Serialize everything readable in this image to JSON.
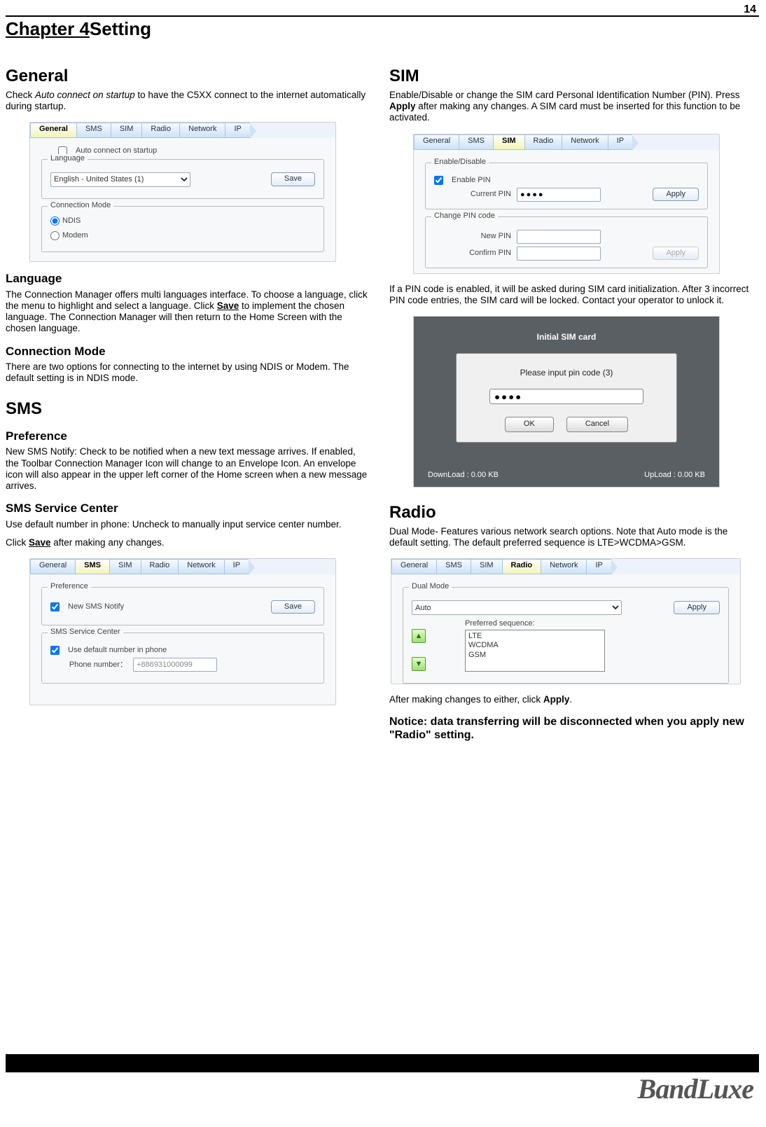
{
  "page_number": "14",
  "chapter": {
    "label": "Chapter 4",
    "title": "Setting"
  },
  "left": {
    "general": {
      "heading": "General",
      "intro_part1": "Check ",
      "intro_italic": "Auto connect on startup",
      "intro_part2": " to have the C5XX connect to the internet automatically during startup."
    },
    "general_fig": {
      "tabs": [
        "General",
        "SMS",
        "SIM",
        "Radio",
        "Network",
        "IP"
      ],
      "active": "General",
      "auto_connect_label": "Auto connect on startup",
      "language_legend": "Language",
      "language_value": "English - United States (1)",
      "save_btn": "Save",
      "conn_legend": "Connection Mode",
      "radio_ndis": "NDIS",
      "radio_modem": "Modem"
    },
    "language": {
      "heading": "Language",
      "body_1": "The Connection Manager offers multi languages interface. To choose a language, click the menu to highlight and select a language. Click ",
      "body_save": "Save",
      "body_2": " to implement the chosen language. The Connection Manager will then return to the Home Screen with the chosen language."
    },
    "conn_mode": {
      "heading": "Connection Mode",
      "body": "There are two options for connecting to the internet by using NDIS or Modem. The default setting is in NDIS mode."
    },
    "sms": {
      "heading": "SMS",
      "pref_heading": "Preference",
      "pref_body": "New SMS Notify: Check to be notified when a new text message arrives. If enabled, the Toolbar Connection Manager Icon will change to an Envelope Icon. An envelope icon will also appear in the upper left corner of the Home screen when a new message arrives.",
      "svc_heading": "SMS Service Center",
      "svc_body1": "Use default number in phone: Uncheck to manually input service center number.",
      "svc_body2_a": "Click ",
      "svc_body2_save": "Save",
      "svc_body2_b": " after making any changes."
    },
    "sms_fig": {
      "tabs": [
        "General",
        "SMS",
        "SIM",
        "Radio",
        "Network",
        "IP"
      ],
      "active": "SMS",
      "pref_legend": "Preference",
      "new_sms_label": "New SMS Notify",
      "save_btn": "Save",
      "svc_legend": "SMS Service Center",
      "default_label": "Use default number in phone",
      "phone_label": "Phone number：",
      "phone_value": "+886931000099"
    }
  },
  "right": {
    "sim": {
      "heading": "SIM",
      "intro_a": "Enable/Disable or change the SIM card Personal Identification Number (PIN). Press ",
      "intro_apply": "Apply",
      "intro_b": " after making any changes. A SIM card must be inserted for this function to be activated."
    },
    "sim_fig": {
      "tabs": [
        "General",
        "SMS",
        "SIM",
        "Radio",
        "Network",
        "IP"
      ],
      "active": "SIM",
      "enable_legend": "Enable/Disable",
      "enable_pin_label": "Enable PIN",
      "current_pin_label": "Current PIN",
      "current_pin_value": "●●●●",
      "apply_btn": "Apply",
      "change_legend": "Change PIN code",
      "new_pin_label": "New PIN",
      "confirm_pin_label": "Confirm PIN",
      "apply_btn2": "Apply"
    },
    "sim_note": "If a PIN code is enabled, it will be asked during SIM card initialization. After 3 incorrect PIN code entries, the SIM card will be locked. Contact your operator to unlock it.",
    "pin_dialog": {
      "banner": "Initial SIM card",
      "prompt": "Please input pin code (3)",
      "input_value": "●●●●",
      "ok": "OK",
      "cancel": "Cancel",
      "download": "DownLoad : 0.00 KB",
      "upload": "UpLoad : 0.00 KB"
    },
    "radio": {
      "heading": "Radio",
      "body": "Dual Mode- Features various network search options. Note that Auto mode is the default setting. The default preferred sequence is LTE>WCDMA>GSM."
    },
    "radio_fig": {
      "tabs": [
        "General",
        "SMS",
        "SIM",
        "Radio",
        "Network",
        "IP"
      ],
      "active": "Radio",
      "dual_legend": "Dual Mode",
      "dual_value": "Auto",
      "pref_label": "Preferred sequence:",
      "seq1": "LTE",
      "seq2": "WCDMA",
      "seq3": "GSM",
      "apply_btn": "Apply"
    },
    "radio_after_a": "After making changes to either, click ",
    "radio_after_apply": "Apply",
    "radio_after_b": ".",
    "notice": "Notice:   data transferring will be disconnected when you apply new \"Radio\" setting."
  },
  "brand": "BandLuxe"
}
